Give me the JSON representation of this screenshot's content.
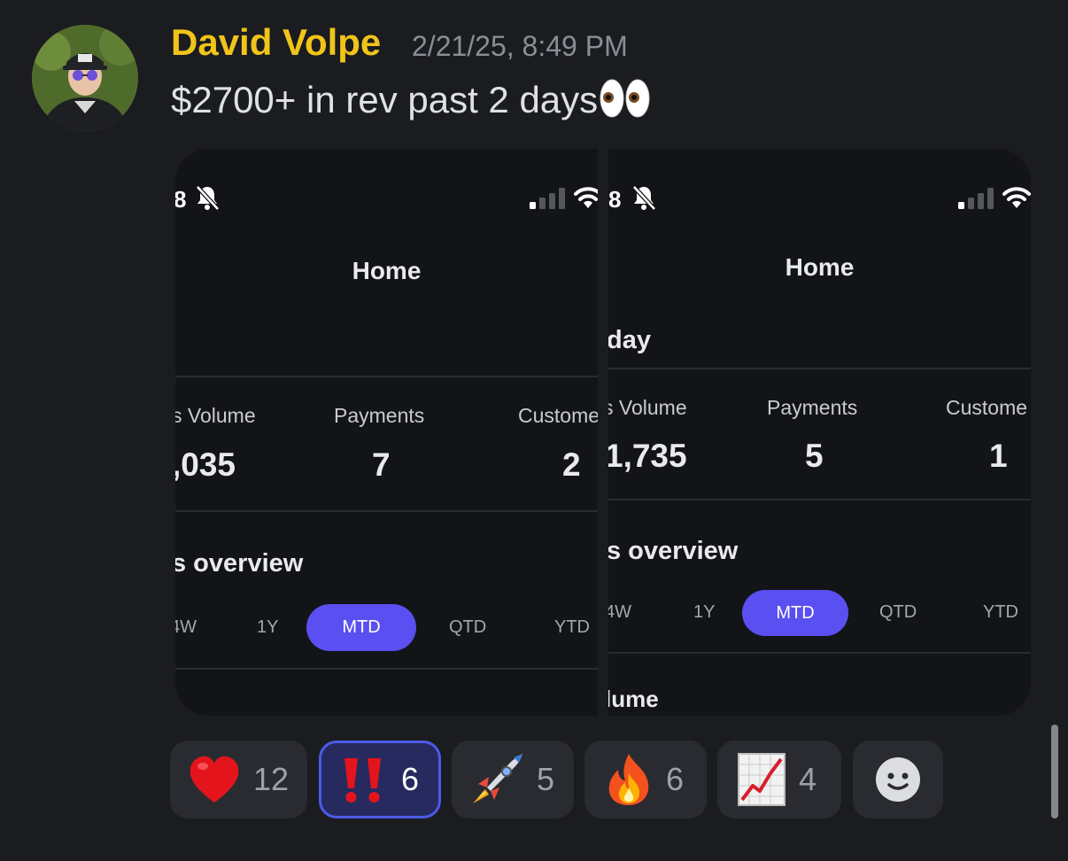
{
  "message": {
    "author": "David Volpe",
    "timestamp": "2/21/25, 8:49 PM",
    "text": "$2700+ in rev past 2 days",
    "text_emoji_icon": "eyes-icon"
  },
  "screenshots": [
    {
      "status_time": "8",
      "title": "Home",
      "metrics": [
        {
          "label": "s Volume",
          "value": ",035"
        },
        {
          "label": "Payments",
          "value": "7"
        },
        {
          "label": "Custome",
          "value": "2"
        }
      ],
      "overview_title": "s overview",
      "ranges": [
        "4W",
        "1Y",
        "MTD",
        "QTD",
        "YTD"
      ],
      "selected_range": "MTD"
    },
    {
      "status_time": "8",
      "title": "Home",
      "today_label": "day",
      "metrics": [
        {
          "label": "s Volume",
          "value": "1,735"
        },
        {
          "label": "Payments",
          "value": "5"
        },
        {
          "label": "Custome",
          "value": "1"
        }
      ],
      "overview_title": "s overview",
      "ranges": [
        "4W",
        "1Y",
        "MTD",
        "QTD",
        "YTD"
      ],
      "selected_range": "MTD",
      "volume_label": "lume"
    }
  ],
  "reactions": [
    {
      "icon": "heart-icon",
      "count": "12"
    },
    {
      "icon": "double-exclamation-icon",
      "count": "6",
      "selected": true
    },
    {
      "icon": "rocket-icon",
      "count": "5"
    },
    {
      "icon": "fire-icon",
      "count": "6"
    },
    {
      "icon": "chart-increasing-icon",
      "count": "4"
    }
  ],
  "add_reaction_icon": "add-reaction-smiley-icon",
  "colors": {
    "author": "#f0c419",
    "accent": "#5a4ff0",
    "background": "#1b1c20"
  }
}
